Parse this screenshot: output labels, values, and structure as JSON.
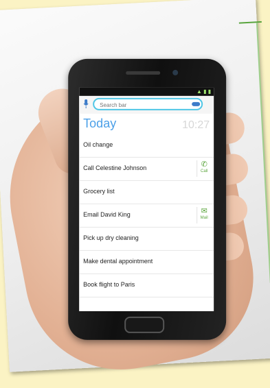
{
  "phone_screen": {
    "search": {
      "placeholder": "Search bar"
    },
    "today": {
      "label": "Today",
      "time": "10:27"
    },
    "tasks": [
      {
        "label": "Oil change"
      },
      {
        "label": "Call Celestine Johnson",
        "action": {
          "icon": "phone-icon",
          "label": "Call"
        }
      },
      {
        "label": "Grocery list"
      },
      {
        "label": "Email David King",
        "action": {
          "icon": "mail-icon",
          "label": "Mail"
        }
      },
      {
        "label": "Pick up dry cleaning"
      },
      {
        "label": "Make dental appointment"
      },
      {
        "label": "Book flight to Paris"
      }
    ]
  },
  "colors": {
    "accent_blue": "#4ca0e8",
    "search_border": "#4ec6e6",
    "action_green": "#5aa53c",
    "background_yellow": "#fbf3c4"
  }
}
